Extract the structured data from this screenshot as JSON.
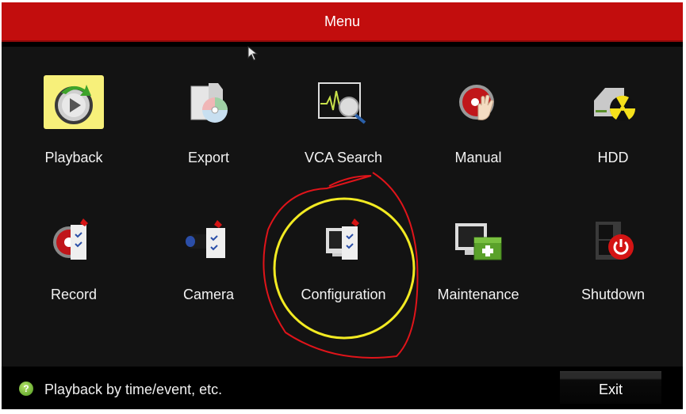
{
  "window": {
    "title": "Menu"
  },
  "menu": {
    "items": [
      {
        "id": "playback",
        "label": "Playback",
        "icon": "playback-icon",
        "selected": true
      },
      {
        "id": "export",
        "label": "Export",
        "icon": "export-disc-icon",
        "selected": false
      },
      {
        "id": "vca-search",
        "label": "VCA Search",
        "icon": "vca-search-icon",
        "selected": false
      },
      {
        "id": "manual",
        "label": "Manual",
        "icon": "manual-record-hand-icon",
        "selected": false
      },
      {
        "id": "hdd",
        "label": "HDD",
        "icon": "hdd-icon",
        "selected": false
      },
      {
        "id": "record",
        "label": "Record",
        "icon": "record-settings-icon",
        "selected": false
      },
      {
        "id": "camera",
        "label": "Camera",
        "icon": "camera-settings-icon",
        "selected": false
      },
      {
        "id": "configuration",
        "label": "Configuration",
        "icon": "configuration-icon",
        "selected": false
      },
      {
        "id": "maintenance",
        "label": "Maintenance",
        "icon": "maintenance-toolbox-icon",
        "selected": false
      },
      {
        "id": "shutdown",
        "label": "Shutdown",
        "icon": "shutdown-power-icon",
        "selected": false
      }
    ]
  },
  "footer": {
    "help_icon": "help-icon",
    "hint": "Playback by time/event, etc.",
    "exit_label": "Exit"
  },
  "annotations": {
    "highlighted_item": "configuration",
    "inner_circle_color": "#f2ea22",
    "outer_scribble_color": "#e0141a"
  },
  "colors": {
    "titlebar": "#c20d0d",
    "background": "#131313",
    "selected_tile": "#f7f07a"
  }
}
